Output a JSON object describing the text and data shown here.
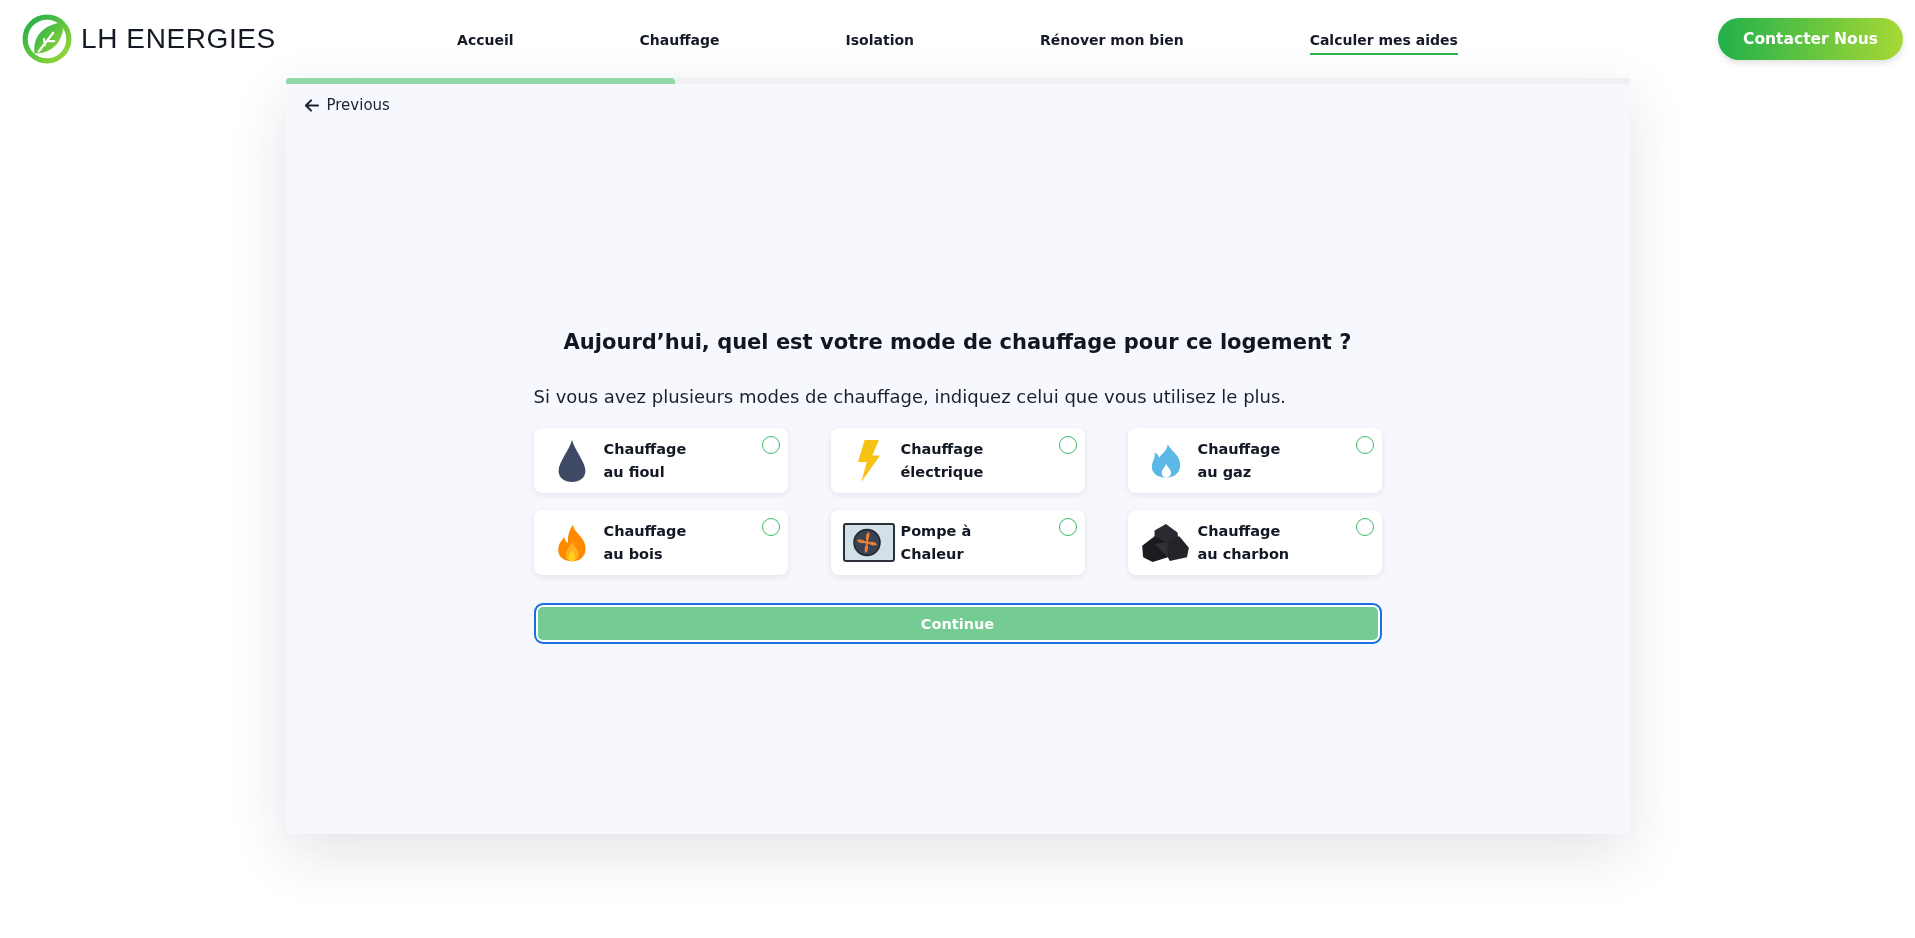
{
  "header": {
    "logo_text": "LH ENERGIES",
    "nav": [
      {
        "label": "Accueil",
        "selected": false
      },
      {
        "label": "Chauffage",
        "selected": false
      },
      {
        "label": "Isolation",
        "selected": false
      },
      {
        "label": "Rénover mon bien",
        "selected": false
      },
      {
        "label": "Calculer mes aides",
        "selected": true
      }
    ],
    "cta": "Contacter Nous"
  },
  "wizard": {
    "progress": {
      "level": 0.29
    },
    "back": "Previous",
    "question": "Aujourd’hui, quel est votre mode de chauffage pour ce logement ?",
    "hint": "Si vous avez plusieurs modes de chauffage, indiquez celui que vous utilisez le plus.",
    "options": [
      {
        "kind": "oil",
        "lines": [
          "Chauffage",
          "au fioul"
        ],
        "selected": false
      },
      {
        "kind": "electric",
        "lines": [
          "Chauffage",
          "électrique"
        ],
        "selected": false
      },
      {
        "kind": "gas",
        "lines": [
          "Chauffage",
          "au gaz"
        ],
        "selected": false
      },
      {
        "kind": "wood",
        "lines": [
          "Chauffage",
          "au bois"
        ],
        "selected": false
      },
      {
        "kind": "heatpump",
        "lines": [
          "Pompe à",
          "Chaleur"
        ],
        "selected": false
      },
      {
        "kind": "coal",
        "lines": [
          "Chauffage",
          "au charbon"
        ],
        "selected": false
      }
    ],
    "submit": {
      "label": "Continue",
      "focused": true
    }
  }
}
